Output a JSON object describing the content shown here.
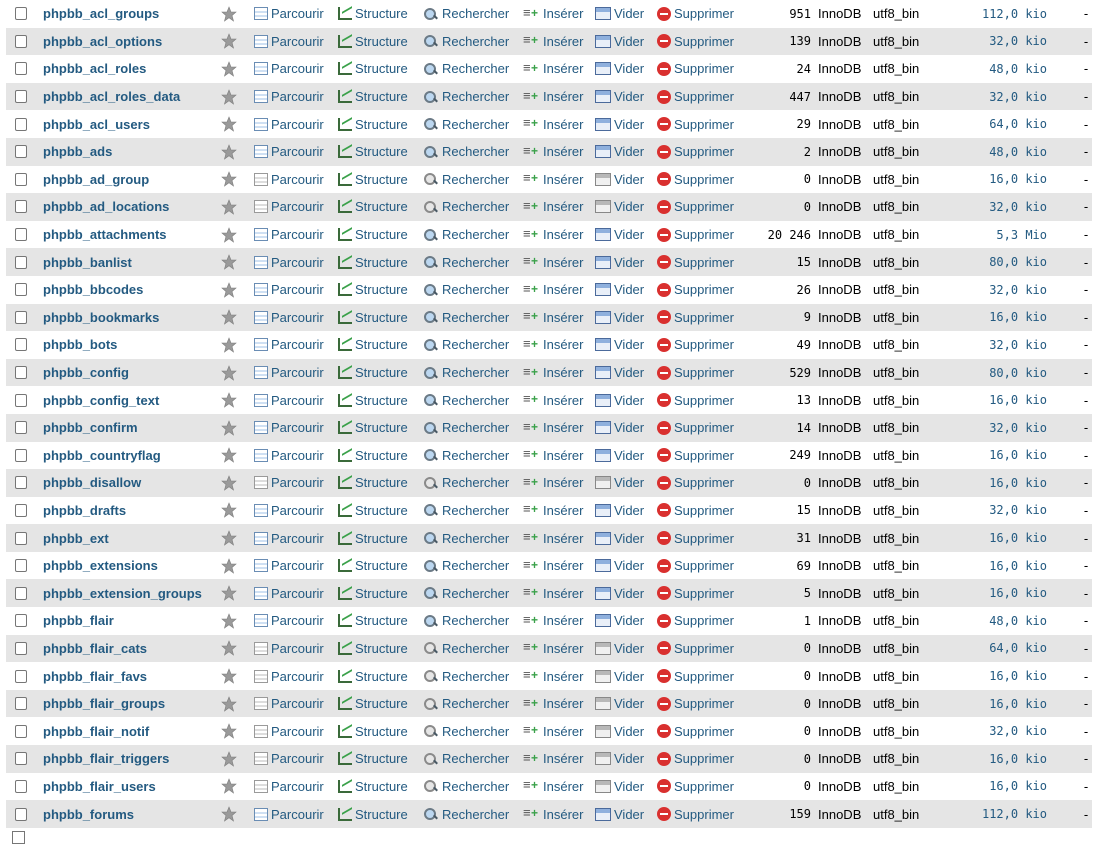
{
  "actions": {
    "browse": "Parcourir",
    "structure": "Structure",
    "search": "Rechercher",
    "insert": "Insérer",
    "empty": "Vider",
    "drop": "Supprimer"
  },
  "overhead": "-",
  "colors": {
    "link": "#235a81",
    "alt_row": "#e5e5e5",
    "drop_icon": "#d9302f"
  },
  "tables": [
    {
      "name": "phpbb_acl_groups",
      "rows": "951",
      "engine": "InnoDB",
      "collation": "utf8_bin",
      "size": "112,0 kio"
    },
    {
      "name": "phpbb_acl_options",
      "rows": "139",
      "engine": "InnoDB",
      "collation": "utf8_bin",
      "size": "32,0 kio"
    },
    {
      "name": "phpbb_acl_roles",
      "rows": "24",
      "engine": "InnoDB",
      "collation": "utf8_bin",
      "size": "48,0 kio"
    },
    {
      "name": "phpbb_acl_roles_data",
      "rows": "447",
      "engine": "InnoDB",
      "collation": "utf8_bin",
      "size": "32,0 kio"
    },
    {
      "name": "phpbb_acl_users",
      "rows": "29",
      "engine": "InnoDB",
      "collation": "utf8_bin",
      "size": "64,0 kio"
    },
    {
      "name": "phpbb_ads",
      "rows": "2",
      "engine": "InnoDB",
      "collation": "utf8_bin",
      "size": "48,0 kio"
    },
    {
      "name": "phpbb_ad_group",
      "rows": "0",
      "engine": "InnoDB",
      "collation": "utf8_bin",
      "size": "16,0 kio"
    },
    {
      "name": "phpbb_ad_locations",
      "rows": "0",
      "engine": "InnoDB",
      "collation": "utf8_bin",
      "size": "32,0 kio"
    },
    {
      "name": "phpbb_attachments",
      "rows": "20 246",
      "engine": "InnoDB",
      "collation": "utf8_bin",
      "size": "5,3 Mio"
    },
    {
      "name": "phpbb_banlist",
      "rows": "15",
      "engine": "InnoDB",
      "collation": "utf8_bin",
      "size": "80,0 kio"
    },
    {
      "name": "phpbb_bbcodes",
      "rows": "26",
      "engine": "InnoDB",
      "collation": "utf8_bin",
      "size": "32,0 kio"
    },
    {
      "name": "phpbb_bookmarks",
      "rows": "9",
      "engine": "InnoDB",
      "collation": "utf8_bin",
      "size": "16,0 kio"
    },
    {
      "name": "phpbb_bots",
      "rows": "49",
      "engine": "InnoDB",
      "collation": "utf8_bin",
      "size": "32,0 kio"
    },
    {
      "name": "phpbb_config",
      "rows": "529",
      "engine": "InnoDB",
      "collation": "utf8_bin",
      "size": "80,0 kio"
    },
    {
      "name": "phpbb_config_text",
      "rows": "13",
      "engine": "InnoDB",
      "collation": "utf8_bin",
      "size": "16,0 kio"
    },
    {
      "name": "phpbb_confirm",
      "rows": "14",
      "engine": "InnoDB",
      "collation": "utf8_bin",
      "size": "32,0 kio"
    },
    {
      "name": "phpbb_countryflag",
      "rows": "249",
      "engine": "InnoDB",
      "collation": "utf8_bin",
      "size": "16,0 kio"
    },
    {
      "name": "phpbb_disallow",
      "rows": "0",
      "engine": "InnoDB",
      "collation": "utf8_bin",
      "size": "16,0 kio"
    },
    {
      "name": "phpbb_drafts",
      "rows": "15",
      "engine": "InnoDB",
      "collation": "utf8_bin",
      "size": "32,0 kio"
    },
    {
      "name": "phpbb_ext",
      "rows": "31",
      "engine": "InnoDB",
      "collation": "utf8_bin",
      "size": "16,0 kio"
    },
    {
      "name": "phpbb_extensions",
      "rows": "69",
      "engine": "InnoDB",
      "collation": "utf8_bin",
      "size": "16,0 kio"
    },
    {
      "name": "phpbb_extension_groups",
      "rows": "5",
      "engine": "InnoDB",
      "collation": "utf8_bin",
      "size": "16,0 kio"
    },
    {
      "name": "phpbb_flair",
      "rows": "1",
      "engine": "InnoDB",
      "collation": "utf8_bin",
      "size": "48,0 kio"
    },
    {
      "name": "phpbb_flair_cats",
      "rows": "0",
      "engine": "InnoDB",
      "collation": "utf8_bin",
      "size": "64,0 kio"
    },
    {
      "name": "phpbb_flair_favs",
      "rows": "0",
      "engine": "InnoDB",
      "collation": "utf8_bin",
      "size": "16,0 kio"
    },
    {
      "name": "phpbb_flair_groups",
      "rows": "0",
      "engine": "InnoDB",
      "collation": "utf8_bin",
      "size": "16,0 kio"
    },
    {
      "name": "phpbb_flair_notif",
      "rows": "0",
      "engine": "InnoDB",
      "collation": "utf8_bin",
      "size": "32,0 kio"
    },
    {
      "name": "phpbb_flair_triggers",
      "rows": "0",
      "engine": "InnoDB",
      "collation": "utf8_bin",
      "size": "16,0 kio"
    },
    {
      "name": "phpbb_flair_users",
      "rows": "0",
      "engine": "InnoDB",
      "collation": "utf8_bin",
      "size": "16,0 kio"
    },
    {
      "name": "phpbb_forums",
      "rows": "159",
      "engine": "InnoDB",
      "collation": "utf8_bin",
      "size": "112,0 kio"
    }
  ]
}
